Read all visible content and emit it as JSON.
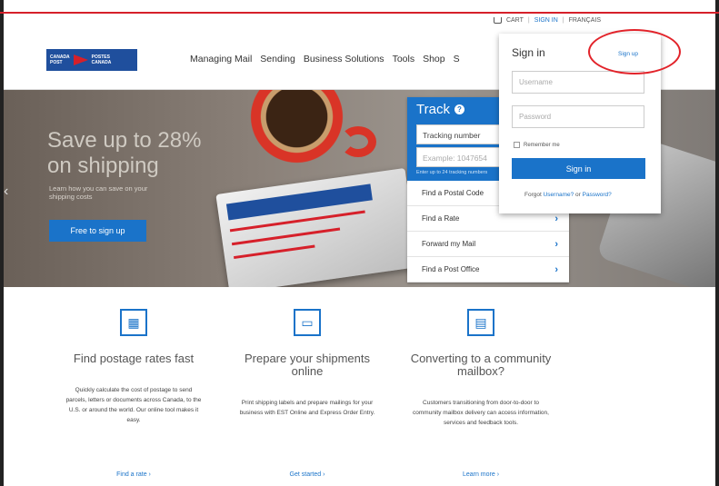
{
  "utility": {
    "cart": "CART",
    "signin": "SIGN IN",
    "language": "FRANÇAIS"
  },
  "logo": {
    "line1": "CANADA POSTES",
    "line2": "POST CANADA"
  },
  "nav": [
    "Managing Mail",
    "Sending",
    "Business Solutions",
    "Tools",
    "Shop",
    "S"
  ],
  "hero": {
    "title_line1": "Save up to 28%",
    "title_line2": "on shipping",
    "subtitle": "Learn how you can save on your shipping costs",
    "button": "Free to sign up"
  },
  "track": {
    "title": "Track",
    "input_value": "Tracking number",
    "input_placeholder": "Example: 1047654",
    "hint": "Enter up to 24 tracking numbers",
    "links": [
      "Find a Postal Code",
      "Find a Rate",
      "Forward my Mail",
      "Find a Post Office"
    ]
  },
  "signin": {
    "title": "Sign in",
    "signup": "Sign up",
    "username_placeholder": "Username",
    "password_placeholder": "Password",
    "remember": "Remember me",
    "button": "Sign in",
    "forgot_prefix": "Forgot",
    "forgot_username": "Username?",
    "forgot_or": "or",
    "forgot_password": "Password?"
  },
  "features": [
    {
      "icon": "calculator-icon",
      "title": "Find postage rates fast",
      "desc": "Quickly calculate the cost of postage to send parcels, letters or documents across Canada, to the U.S. or around the world. Our online tool makes it easy.",
      "link": "Find a rate"
    },
    {
      "icon": "laptop-label-icon",
      "title": "Prepare your shipments online",
      "desc": "Print shipping labels and prepare mailings for your business with EST Online and Express Order Entry.",
      "link": "Get started"
    },
    {
      "icon": "mailbox-icon",
      "title": "Converting to a community mailbox?",
      "desc": "Customers transitioning from door-to-door to community mailbox delivery can access information, services and feedback tools.",
      "link": "Learn more"
    }
  ],
  "colors": {
    "brand_blue": "#1a73c9",
    "brand_red": "#d6202a"
  }
}
